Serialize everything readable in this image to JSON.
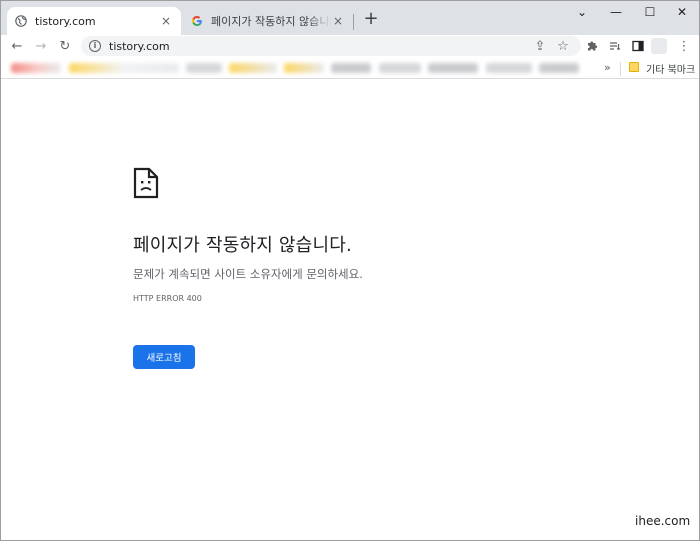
{
  "tabs": [
    {
      "title": "tistory.com",
      "close": "×"
    },
    {
      "title": "페이지가 작동하지 않습니다. - Chrome",
      "close": "×"
    }
  ],
  "window_controls": {
    "minimize": "⌄",
    "restore": "—",
    "maximize": "☐",
    "close": "✕"
  },
  "new_tab": "+",
  "toolbar": {
    "url": "tistory.com",
    "info_symbol": "i",
    "back": "←",
    "forward": "→",
    "reload": "↻",
    "share": "⇪",
    "star": "☆",
    "menu": "⋮"
  },
  "bookmarks": {
    "more": "»",
    "other_label": "기타 북마크"
  },
  "error_page": {
    "title": "페이지가 작동하지 않습니다.",
    "subtitle": "문제가 계속되면 사이트 소유자에게 문의하세요.",
    "code": "HTTP ERROR 400",
    "reload_label": "새로고침"
  },
  "watermark": "ihee.com",
  "colors": {
    "accent": "#1a73e8",
    "tabstrip": "#dee1e6",
    "omnibox": "#f1f3f4"
  }
}
